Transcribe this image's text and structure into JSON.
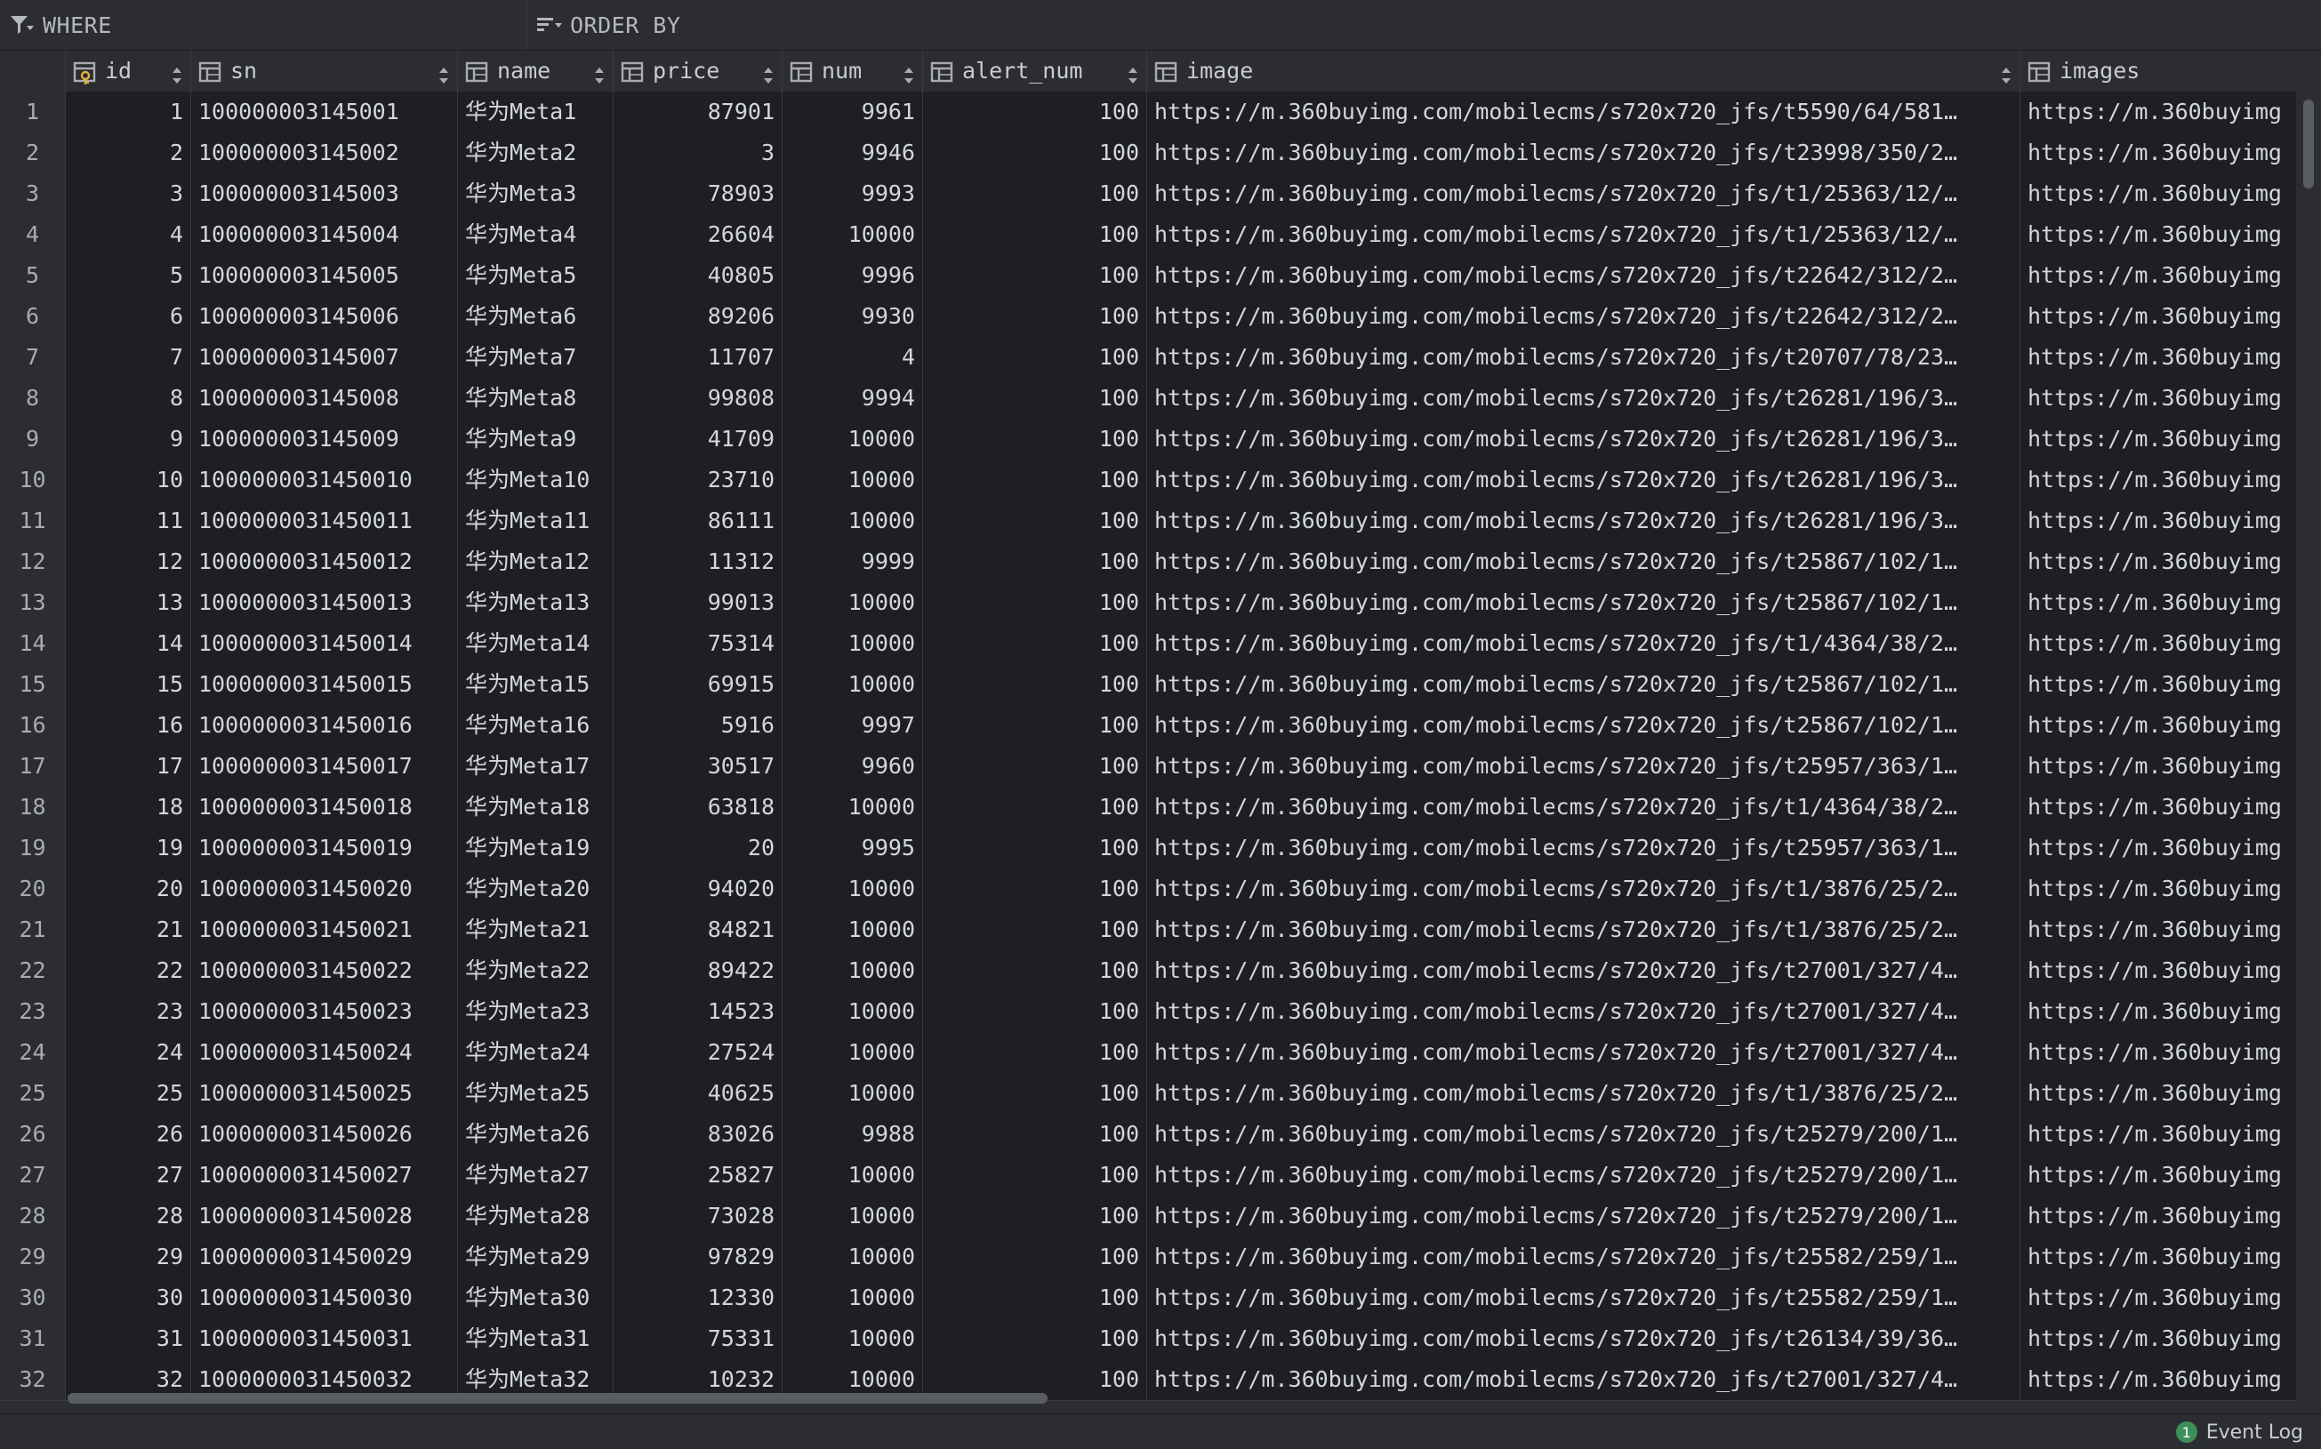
{
  "filter": {
    "where_label": "WHERE",
    "order_label": "ORDER BY"
  },
  "columns": [
    {
      "key": "id",
      "label": "id",
      "icon": "primary-key-column-icon",
      "align": "right"
    },
    {
      "key": "sn",
      "label": "sn",
      "icon": "column-icon",
      "align": "left"
    },
    {
      "key": "name",
      "label": "name",
      "icon": "column-icon",
      "align": "left"
    },
    {
      "key": "price",
      "label": "price",
      "icon": "column-icon",
      "align": "right"
    },
    {
      "key": "num",
      "label": "num",
      "icon": "column-icon",
      "align": "right"
    },
    {
      "key": "alert_num",
      "label": "alert_num",
      "icon": "column-icon",
      "align": "right"
    },
    {
      "key": "image",
      "label": "image",
      "icon": "column-icon",
      "align": "left"
    },
    {
      "key": "images",
      "label": "images",
      "icon": "column-icon",
      "align": "left"
    }
  ],
  "rows": [
    {
      "n": "1",
      "id": "1",
      "sn": "100000003145001",
      "name": "华为Meta1",
      "price": "87901",
      "num": "9961",
      "alert_num": "100",
      "image": "https://m.360buyimg.com/mobilecms/s720x720_jfs/t5590/64/581…",
      "images": "https://m.360buyimg"
    },
    {
      "n": "2",
      "id": "2",
      "sn": "100000003145002",
      "name": "华为Meta2",
      "price": "3",
      "num": "9946",
      "alert_num": "100",
      "image": "https://m.360buyimg.com/mobilecms/s720x720_jfs/t23998/350/2…",
      "images": "https://m.360buyimg"
    },
    {
      "n": "3",
      "id": "3",
      "sn": "100000003145003",
      "name": "华为Meta3",
      "price": "78903",
      "num": "9993",
      "alert_num": "100",
      "image": "https://m.360buyimg.com/mobilecms/s720x720_jfs/t1/25363/12/…",
      "images": "https://m.360buyimg"
    },
    {
      "n": "4",
      "id": "4",
      "sn": "100000003145004",
      "name": "华为Meta4",
      "price": "26604",
      "num": "10000",
      "alert_num": "100",
      "image": "https://m.360buyimg.com/mobilecms/s720x720_jfs/t1/25363/12/…",
      "images": "https://m.360buyimg"
    },
    {
      "n": "5",
      "id": "5",
      "sn": "100000003145005",
      "name": "华为Meta5",
      "price": "40805",
      "num": "9996",
      "alert_num": "100",
      "image": "https://m.360buyimg.com/mobilecms/s720x720_jfs/t22642/312/2…",
      "images": "https://m.360buyimg"
    },
    {
      "n": "6",
      "id": "6",
      "sn": "100000003145006",
      "name": "华为Meta6",
      "price": "89206",
      "num": "9930",
      "alert_num": "100",
      "image": "https://m.360buyimg.com/mobilecms/s720x720_jfs/t22642/312/2…",
      "images": "https://m.360buyimg"
    },
    {
      "n": "7",
      "id": "7",
      "sn": "100000003145007",
      "name": "华为Meta7",
      "price": "11707",
      "num": "4",
      "alert_num": "100",
      "image": "https://m.360buyimg.com/mobilecms/s720x720_jfs/t20707/78/23…",
      "images": "https://m.360buyimg"
    },
    {
      "n": "8",
      "id": "8",
      "sn": "100000003145008",
      "name": "华为Meta8",
      "price": "99808",
      "num": "9994",
      "alert_num": "100",
      "image": "https://m.360buyimg.com/mobilecms/s720x720_jfs/t26281/196/3…",
      "images": "https://m.360buyimg"
    },
    {
      "n": "9",
      "id": "9",
      "sn": "100000003145009",
      "name": "华为Meta9",
      "price": "41709",
      "num": "10000",
      "alert_num": "100",
      "image": "https://m.360buyimg.com/mobilecms/s720x720_jfs/t26281/196/3…",
      "images": "https://m.360buyimg"
    },
    {
      "n": "10",
      "id": "10",
      "sn": "1000000031450010",
      "name": "华为Meta10",
      "price": "23710",
      "num": "10000",
      "alert_num": "100",
      "image": "https://m.360buyimg.com/mobilecms/s720x720_jfs/t26281/196/3…",
      "images": "https://m.360buyimg"
    },
    {
      "n": "11",
      "id": "11",
      "sn": "1000000031450011",
      "name": "华为Meta11",
      "price": "86111",
      "num": "10000",
      "alert_num": "100",
      "image": "https://m.360buyimg.com/mobilecms/s720x720_jfs/t26281/196/3…",
      "images": "https://m.360buyimg"
    },
    {
      "n": "12",
      "id": "12",
      "sn": "1000000031450012",
      "name": "华为Meta12",
      "price": "11312",
      "num": "9999",
      "alert_num": "100",
      "image": "https://m.360buyimg.com/mobilecms/s720x720_jfs/t25867/102/1…",
      "images": "https://m.360buyimg"
    },
    {
      "n": "13",
      "id": "13",
      "sn": "1000000031450013",
      "name": "华为Meta13",
      "price": "99013",
      "num": "10000",
      "alert_num": "100",
      "image": "https://m.360buyimg.com/mobilecms/s720x720_jfs/t25867/102/1…",
      "images": "https://m.360buyimg"
    },
    {
      "n": "14",
      "id": "14",
      "sn": "1000000031450014",
      "name": "华为Meta14",
      "price": "75314",
      "num": "10000",
      "alert_num": "100",
      "image": "https://m.360buyimg.com/mobilecms/s720x720_jfs/t1/4364/38/2…",
      "images": "https://m.360buyimg"
    },
    {
      "n": "15",
      "id": "15",
      "sn": "1000000031450015",
      "name": "华为Meta15",
      "price": "69915",
      "num": "10000",
      "alert_num": "100",
      "image": "https://m.360buyimg.com/mobilecms/s720x720_jfs/t25867/102/1…",
      "images": "https://m.360buyimg"
    },
    {
      "n": "16",
      "id": "16",
      "sn": "1000000031450016",
      "name": "华为Meta16",
      "price": "5916",
      "num": "9997",
      "alert_num": "100",
      "image": "https://m.360buyimg.com/mobilecms/s720x720_jfs/t25867/102/1…",
      "images": "https://m.360buyimg"
    },
    {
      "n": "17",
      "id": "17",
      "sn": "1000000031450017",
      "name": "华为Meta17",
      "price": "30517",
      "num": "9960",
      "alert_num": "100",
      "image": "https://m.360buyimg.com/mobilecms/s720x720_jfs/t25957/363/1…",
      "images": "https://m.360buyimg"
    },
    {
      "n": "18",
      "id": "18",
      "sn": "1000000031450018",
      "name": "华为Meta18",
      "price": "63818",
      "num": "10000",
      "alert_num": "100",
      "image": "https://m.360buyimg.com/mobilecms/s720x720_jfs/t1/4364/38/2…",
      "images": "https://m.360buyimg"
    },
    {
      "n": "19",
      "id": "19",
      "sn": "1000000031450019",
      "name": "华为Meta19",
      "price": "20",
      "num": "9995",
      "alert_num": "100",
      "image": "https://m.360buyimg.com/mobilecms/s720x720_jfs/t25957/363/1…",
      "images": "https://m.360buyimg"
    },
    {
      "n": "20",
      "id": "20",
      "sn": "1000000031450020",
      "name": "华为Meta20",
      "price": "94020",
      "num": "10000",
      "alert_num": "100",
      "image": "https://m.360buyimg.com/mobilecms/s720x720_jfs/t1/3876/25/2…",
      "images": "https://m.360buyimg"
    },
    {
      "n": "21",
      "id": "21",
      "sn": "1000000031450021",
      "name": "华为Meta21",
      "price": "84821",
      "num": "10000",
      "alert_num": "100",
      "image": "https://m.360buyimg.com/mobilecms/s720x720_jfs/t1/3876/25/2…",
      "images": "https://m.360buyimg"
    },
    {
      "n": "22",
      "id": "22",
      "sn": "1000000031450022",
      "name": "华为Meta22",
      "price": "89422",
      "num": "10000",
      "alert_num": "100",
      "image": "https://m.360buyimg.com/mobilecms/s720x720_jfs/t27001/327/4…",
      "images": "https://m.360buyimg"
    },
    {
      "n": "23",
      "id": "23",
      "sn": "1000000031450023",
      "name": "华为Meta23",
      "price": "14523",
      "num": "10000",
      "alert_num": "100",
      "image": "https://m.360buyimg.com/mobilecms/s720x720_jfs/t27001/327/4…",
      "images": "https://m.360buyimg"
    },
    {
      "n": "24",
      "id": "24",
      "sn": "1000000031450024",
      "name": "华为Meta24",
      "price": "27524",
      "num": "10000",
      "alert_num": "100",
      "image": "https://m.360buyimg.com/mobilecms/s720x720_jfs/t27001/327/4…",
      "images": "https://m.360buyimg"
    },
    {
      "n": "25",
      "id": "25",
      "sn": "1000000031450025",
      "name": "华为Meta25",
      "price": "40625",
      "num": "10000",
      "alert_num": "100",
      "image": "https://m.360buyimg.com/mobilecms/s720x720_jfs/t1/3876/25/2…",
      "images": "https://m.360buyimg"
    },
    {
      "n": "26",
      "id": "26",
      "sn": "1000000031450026",
      "name": "华为Meta26",
      "price": "83026",
      "num": "9988",
      "alert_num": "100",
      "image": "https://m.360buyimg.com/mobilecms/s720x720_jfs/t25279/200/1…",
      "images": "https://m.360buyimg"
    },
    {
      "n": "27",
      "id": "27",
      "sn": "1000000031450027",
      "name": "华为Meta27",
      "price": "25827",
      "num": "10000",
      "alert_num": "100",
      "image": "https://m.360buyimg.com/mobilecms/s720x720_jfs/t25279/200/1…",
      "images": "https://m.360buyimg"
    },
    {
      "n": "28",
      "id": "28",
      "sn": "1000000031450028",
      "name": "华为Meta28",
      "price": "73028",
      "num": "10000",
      "alert_num": "100",
      "image": "https://m.360buyimg.com/mobilecms/s720x720_jfs/t25279/200/1…",
      "images": "https://m.360buyimg"
    },
    {
      "n": "29",
      "id": "29",
      "sn": "1000000031450029",
      "name": "华为Meta29",
      "price": "97829",
      "num": "10000",
      "alert_num": "100",
      "image": "https://m.360buyimg.com/mobilecms/s720x720_jfs/t25582/259/1…",
      "images": "https://m.360buyimg"
    },
    {
      "n": "30",
      "id": "30",
      "sn": "1000000031450030",
      "name": "华为Meta30",
      "price": "12330",
      "num": "10000",
      "alert_num": "100",
      "image": "https://m.360buyimg.com/mobilecms/s720x720_jfs/t25582/259/1…",
      "images": "https://m.360buyimg"
    },
    {
      "n": "31",
      "id": "31",
      "sn": "1000000031450031",
      "name": "华为Meta31",
      "price": "75331",
      "num": "10000",
      "alert_num": "100",
      "image": "https://m.360buyimg.com/mobilecms/s720x720_jfs/t26134/39/36…",
      "images": "https://m.360buyimg"
    },
    {
      "n": "32",
      "id": "32",
      "sn": "1000000031450032",
      "name": "华为Meta32",
      "price": "10232",
      "num": "10000",
      "alert_num": "100",
      "image": "https://m.360buyimg.com/mobilecms/s720x720_jfs/t27001/327/4…",
      "images": "https://m.360buyimg"
    }
  ],
  "status": {
    "event_count": "1",
    "event_log_label": "Event Log"
  },
  "colors": {
    "background": "#2b2d30",
    "cell_background": "#1e1f22",
    "grid_line": "#393b40",
    "text": "#d3d6da",
    "badge": "#3d8f58"
  }
}
